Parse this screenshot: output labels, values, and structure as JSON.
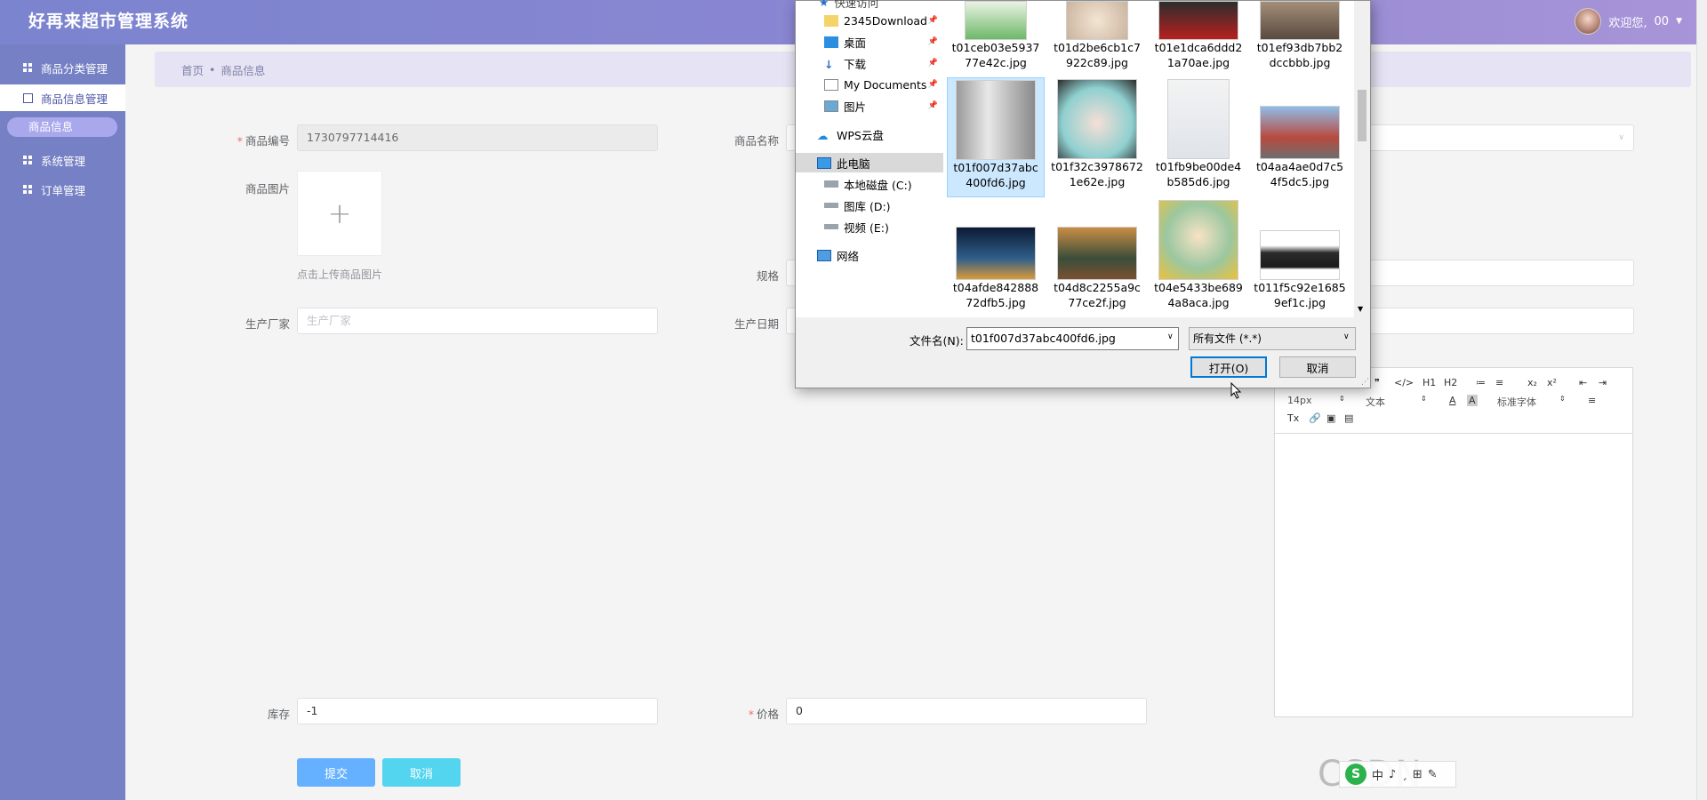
{
  "header": {
    "app_title": "好再来超市管理系统",
    "welcome": "欢迎您,",
    "username": "00"
  },
  "sidebar": {
    "items": [
      {
        "label": "商品分类管理"
      },
      {
        "label": "商品信息管理"
      },
      {
        "label": "系统管理"
      },
      {
        "label": "订单管理"
      }
    ],
    "sub_item": "商品信息"
  },
  "breadcrumb": {
    "home": "首页",
    "separator": "•",
    "current": "商品信息"
  },
  "form": {
    "code_label": "商品编号",
    "code_value": "1730797714416",
    "name_label": "商品名称",
    "image_label": "商品图片",
    "upload_plus": "+",
    "upload_tip": "点击上传商品图片",
    "spec_label": "规格",
    "maker_label": "生产厂家",
    "maker_placeholder": "生产厂家",
    "date_label": "生产日期",
    "stock_label": "库存",
    "stock_value": "-1",
    "price_label": "价格",
    "price_value": "0",
    "submit_label": "提交",
    "cancel_label": "取消"
  },
  "editor": {
    "row1": [
      "❞",
      "</>",
      "H1",
      "H2",
      "≔",
      "≡",
      "x₂",
      "x²",
      "⇤",
      "⇥"
    ],
    "font_size": "14px",
    "text_type": "文本",
    "font_family": "标准字体",
    "row3": [
      "Tx",
      "🔗",
      "▣",
      "▤"
    ]
  },
  "dialog": {
    "nav": [
      {
        "label": "2345Download",
        "icon": "folder-icon",
        "pinned": true
      },
      {
        "label": "桌面",
        "icon": "desktop-icon",
        "pinned": true
      },
      {
        "label": "下载",
        "icon": "download-icon",
        "pinned": true
      },
      {
        "label": "My Documents",
        "icon": "documents-icon",
        "pinned": true
      },
      {
        "label": "图片",
        "icon": "pictures-icon",
        "pinned": true
      },
      {
        "label": "WPS云盘",
        "icon": "cloud-icon",
        "pinned": false
      },
      {
        "label": "此电脑",
        "icon": "computer-icon",
        "pinned": false
      },
      {
        "label": "本地磁盘 (C:)",
        "icon": "disk-icon",
        "pinned": false
      },
      {
        "label": "图库 (D:)",
        "icon": "disk-icon",
        "pinned": false
      },
      {
        "label": "视频 (E:)",
        "icon": "disk-icon",
        "pinned": false
      },
      {
        "label": "网络",
        "icon": "network-icon",
        "pinned": false
      }
    ],
    "files": [
      {
        "name": "t01ceb03e593777e42c.jpg",
        "line1": "t01ceb03e5937",
        "line2": "77e42c.jpg"
      },
      {
        "name": "t01d2be6cb1c7922c89.jpg",
        "line1": "t01d2be6cb1c7",
        "line2": "922c89.jpg"
      },
      {
        "name": "t01e1dca6ddd21a70ae.jpg",
        "line1": "t01e1dca6ddd2",
        "line2": "1a70ae.jpg"
      },
      {
        "name": "t01ef93db7bb2dccbbb.jpg",
        "line1": "t01ef93db7bb2",
        "line2": "dccbbb.jpg"
      },
      {
        "name": "t01f007d37abc400fd6.jpg",
        "line1": "t01f007d37abc",
        "line2": "400fd6.jpg"
      },
      {
        "name": "t01f32c39786721e62e.jpg",
        "line1": "t01f32c3978672",
        "line2": "1e62e.jpg"
      },
      {
        "name": "t01fb9be00de4b585d6.jpg",
        "line1": "t01fb9be00de4",
        "line2": "b585d6.jpg"
      },
      {
        "name": "t04aa4ae0d7c54f5dc5.jpg",
        "line1": "t04aa4ae0d7c5",
        "line2": "4f5dc5.jpg"
      },
      {
        "name": "t04afde84288872dfb5.jpg",
        "line1": "t04afde842888",
        "line2": "72dfb5.jpg"
      },
      {
        "name": "t04d8c2255a9c77ce2f.jpg",
        "line1": "t04d8c2255a9c",
        "line2": "77ce2f.jpg"
      },
      {
        "name": "t04e5433be6894a8aca.jpg",
        "line1": "t04e5433be689",
        "line2": "4a8aca.jpg"
      },
      {
        "name": "t011f5c92e16859ef1c.jpg",
        "line1": "t011f5c92e1685",
        "line2": "9ef1c.jpg"
      }
    ],
    "filename_label": "文件名(N):",
    "filename_value": "t01f007d37abc400fd6.jpg",
    "filetype_value": "所有文件 (*.*)",
    "open_label": "打开(O)",
    "cancel_label": "取消"
  },
  "watermark": "CSDN @qq_37866497317",
  "ime": [
    "中",
    "♪",
    "ˏ",
    "⊞",
    "✎"
  ],
  "colors": {
    "header_start": "#7b84cf",
    "header_end": "#a894d8",
    "sidebar": "#7680c4",
    "submit": "#66b1ff",
    "cancel": "#53d4ef",
    "selection": "#cce8ff"
  }
}
